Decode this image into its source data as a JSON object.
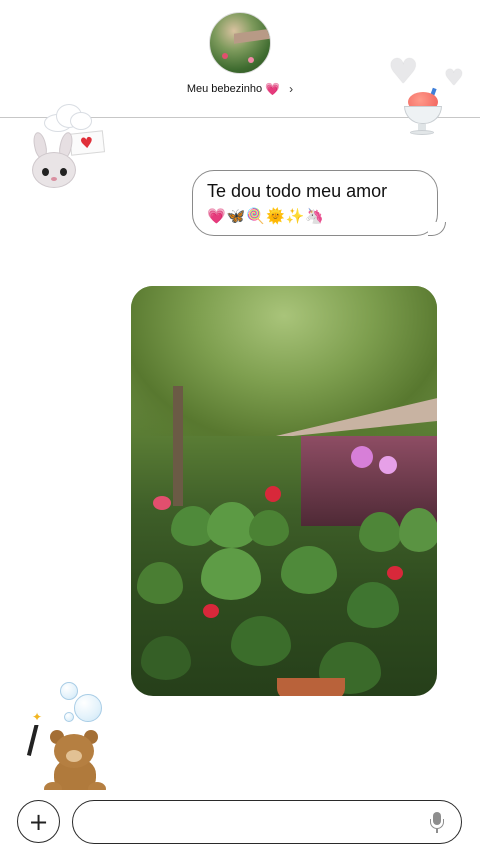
{
  "header": {
    "contact_name": "Meu bebezinho",
    "name_emoji": "💗",
    "chevron": "›"
  },
  "messages": [
    {
      "text": "Te dou todo meu amor",
      "emojis": "💗🦋🍭🌞✨🦄"
    }
  ],
  "composer": {
    "plus_label": "+",
    "input_value": "",
    "input_placeholder": ""
  },
  "colors": {
    "divider": "#c7c7c7",
    "bubble_border": "#8a8a8a",
    "composer_border": "#2a2a2a"
  },
  "icons": [
    "avatar",
    "chevron-right-icon",
    "plus-icon",
    "microphone-icon"
  ]
}
